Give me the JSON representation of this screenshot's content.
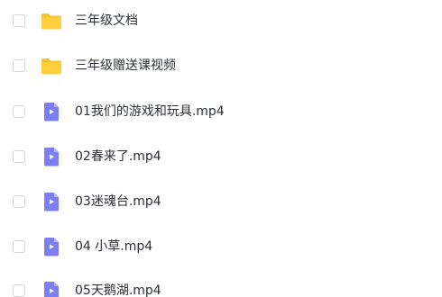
{
  "files": [
    {
      "name": "三年级文档",
      "type": "folder",
      "icon": "folder-icon"
    },
    {
      "name": "三年级赠送课视频",
      "type": "folder",
      "icon": "folder-icon"
    },
    {
      "name": "01我们的游戏和玩具.mp4",
      "type": "video",
      "icon": "video-file-icon"
    },
    {
      "name": "02春来了.mp4",
      "type": "video",
      "icon": "video-file-icon"
    },
    {
      "name": "03迷魂台.mp4",
      "type": "video",
      "icon": "video-file-icon"
    },
    {
      "name": "04 小草.mp4",
      "type": "video",
      "icon": "video-file-icon"
    },
    {
      "name": "05天鹅湖.mp4",
      "type": "video",
      "icon": "video-file-icon"
    }
  ],
  "colors": {
    "folder": "#ffcf3d",
    "folder_back": "#f7c12c",
    "video": "#7b7ff2",
    "video_fold": "#b3b6f8",
    "text": "#2b2f36",
    "checkbox_border": "#d5d7dc"
  }
}
